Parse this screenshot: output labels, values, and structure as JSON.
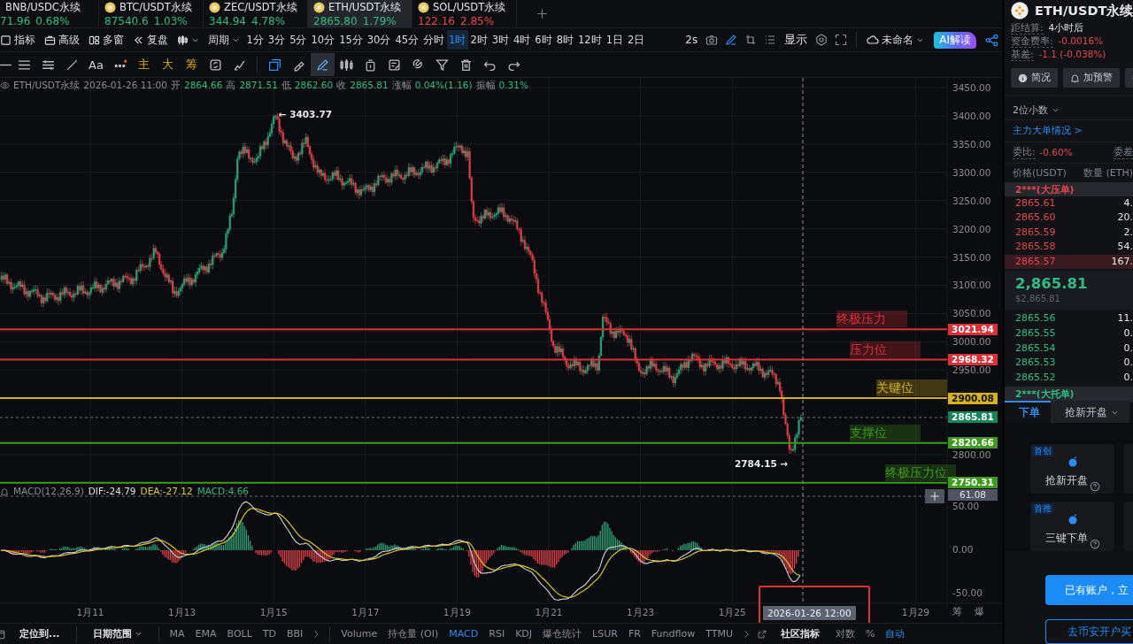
{
  "ticker_tabs": [
    {
      "symbol": "BNB/USDC永续",
      "price": "71.96",
      "change": "0.68%",
      "negative": false,
      "selected": false
    },
    {
      "symbol": "BTC/USDT永续",
      "price": "87540.6",
      "change": "1.03%",
      "negative": false,
      "selected": false
    },
    {
      "symbol": "ZEC/USDT永续",
      "price": "344.94",
      "change": "4.78%",
      "negative": false,
      "selected": false
    },
    {
      "symbol": "ETH/USDT永续",
      "price": "2865.80",
      "change": "1.79%",
      "negative": false,
      "selected": true
    },
    {
      "symbol": "SOL/USDT永续",
      "price": "122.16",
      "change": "2.85%",
      "negative": true,
      "selected": false
    }
  ],
  "toolbar": {
    "tools": [
      {
        "label": "指标"
      },
      {
        "label": "高级"
      },
      {
        "label": "多窗"
      },
      {
        "label": "复盘"
      }
    ],
    "period": "周期",
    "intervals": [
      {
        "label": "1分",
        "selected": false
      },
      {
        "label": "3分",
        "selected": false
      },
      {
        "label": "5分",
        "selected": false
      },
      {
        "label": "10分",
        "selected": false
      },
      {
        "label": "15分",
        "selected": false
      },
      {
        "label": "30分",
        "selected": false
      },
      {
        "label": "45分",
        "selected": false
      },
      {
        "label": "分时",
        "selected": false
      },
      {
        "label": "1时",
        "selected": true
      },
      {
        "label": "2时",
        "selected": false
      },
      {
        "label": "3时",
        "selected": false
      },
      {
        "label": "4时",
        "selected": false
      },
      {
        "label": "6时",
        "selected": false
      },
      {
        "label": "8时",
        "selected": false
      },
      {
        "label": "12时",
        "selected": false
      },
      {
        "label": "1日",
        "selected": false
      },
      {
        "label": "2日",
        "selected": false
      }
    ],
    "refresh": "2s",
    "display": "显示",
    "layout_name": "未命名",
    "ai_button": "AI解读"
  },
  "drawing_tools": [
    {
      "kind": "icon",
      "selected": false,
      "active": false
    },
    {
      "kind": "icon",
      "selected": false,
      "active": false
    },
    {
      "kind": "icon",
      "selected": false,
      "active": false
    },
    {
      "kind": "icon",
      "selected": false,
      "active": false
    },
    {
      "kind": "text",
      "label": "Aa"
    },
    {
      "kind": "icon",
      "selected": false,
      "active": false
    },
    {
      "kind": "quick",
      "label": "主"
    },
    {
      "kind": "quick",
      "label": "大"
    },
    {
      "kind": "quick",
      "label": "筹"
    },
    {
      "kind": "icon",
      "selected": false,
      "active": false
    },
    {
      "kind": "icon",
      "selected": false,
      "active": false
    },
    {
      "kind": "icon",
      "selected": false,
      "active": true
    },
    {
      "kind": "icon",
      "selected": false,
      "active": false
    },
    {
      "kind": "icon",
      "selected": true,
      "active": false
    },
    {
      "kind": "icon",
      "selected": false,
      "active": false
    },
    {
      "kind": "icon",
      "selected": false,
      "active": false
    },
    {
      "kind": "icon",
      "selected": false,
      "active": false
    },
    {
      "kind": "icon",
      "selected": false,
      "active": false
    },
    {
      "kind": "icon",
      "selected": false,
      "active": false
    },
    {
      "kind": "icon",
      "selected": false,
      "active": false
    },
    {
      "kind": "icon",
      "selected": false,
      "active": false
    },
    {
      "kind": "icon",
      "selected": false,
      "active": false
    }
  ],
  "info_line": {
    "symbol": "ETH/USDT永续",
    "time": "2026-01-26 11:00",
    "fields": [
      {
        "label": "开",
        "value": "2864.66"
      },
      {
        "label": "高",
        "value": "2871.51"
      },
      {
        "label": "低",
        "value": "2862.60"
      },
      {
        "label": "收",
        "value": "2865.81"
      },
      {
        "label": "涨幅",
        "value": "0.04%(1.16)"
      },
      {
        "label": "振幅",
        "value": "0.31%"
      }
    ]
  },
  "chart": {
    "price_ticks": [
      "3450.00",
      "3400.00",
      "3350.00",
      "3300.00",
      "3250.00",
      "3200.00",
      "3150.00",
      "3100.00",
      "3050.00",
      "3000.00",
      "2950.00",
      "2800.00"
    ],
    "high_marker": "← 3403.77",
    "low_marker": "2784.15 →",
    "levels": [
      {
        "label": "终极压力",
        "price": "3021.94",
        "color": "#d9303a"
      },
      {
        "label": "压力位",
        "price": "2968.32",
        "color": "#d9303a"
      },
      {
        "label": "关键位",
        "price": "2900.08",
        "color": "#d4b21f"
      },
      {
        "label": "支撑位",
        "price": "2820.66",
        "color": "#3f9a1d"
      },
      {
        "label": "终极压力位",
        "price": "2750.31",
        "color": "#3f9a1d"
      }
    ],
    "current_price": "2865.81",
    "crosshair_time": "2026-01-26 12:00",
    "time_labels": [
      "1月11",
      "1月13",
      "1月15",
      "1月17",
      "1月19",
      "1月21",
      "1月23",
      "1月25",
      "1月29"
    ],
    "axis_corner": [
      "筹",
      "爆"
    ]
  },
  "macd": {
    "title": "MACD(12,26,9)",
    "dif": "DIF:-24.79",
    "dea": "DEA:-27.12",
    "macd": "MACD:4.66",
    "ticks": [
      "50.00",
      "0.00",
      "-50.00"
    ],
    "cursor_value": "61.08"
  },
  "bottom_bar": {
    "locate": "定位到...",
    "date_range": "日期范围",
    "main_indicators": [
      "MA",
      "EMA",
      "BOLL",
      "TD",
      "BBI"
    ],
    "sub_indicators": [
      {
        "label": "Volume",
        "selected": false
      },
      {
        "label": "持仓量 (OI)",
        "selected": false
      },
      {
        "label": "MACD",
        "selected": true
      },
      {
        "label": "RSI",
        "selected": false
      },
      {
        "label": "KDJ",
        "selected": false
      },
      {
        "label": "爆仓统计",
        "selected": false
      },
      {
        "label": "LSUR",
        "selected": false
      },
      {
        "label": "FR",
        "selected": false
      },
      {
        "label": "Fundflow",
        "selected": false
      },
      {
        "label": "TTMU",
        "selected": false
      }
    ],
    "community": "社区指标",
    "options": [
      {
        "label": "对数",
        "selected": false
      },
      {
        "label": "%",
        "selected": false
      },
      {
        "label": "自动",
        "selected": true
      }
    ]
  },
  "side_panel": {
    "symbol": "ETH/USDT永续",
    "stats": [
      {
        "label": "距结算:",
        "value": "4小时后",
        "negative": false
      },
      {
        "label": "资金费率:",
        "value": "-0.0016%",
        "negative": true
      },
      {
        "label": "基差:",
        "value": "-1.1 (-0.038%)",
        "negative": true
      }
    ],
    "buttons": [
      "简况",
      "加预警"
    ],
    "decimals": "2位小数",
    "big_orders_link": "主力大单情况 >",
    "ratio_label": "委比:",
    "ratio_value": "-0.60%",
    "diff_label": "委差",
    "columns": [
      "价格(USDT)",
      "数量 (ETH)"
    ],
    "ask_header": "2***(大压单)",
    "asks": [
      {
        "price": "2865.61",
        "amount": "4.",
        "highlight": false
      },
      {
        "price": "2865.60",
        "amount": "20.",
        "highlight": false
      },
      {
        "price": "2865.59",
        "amount": "2.",
        "highlight": false
      },
      {
        "price": "2865.58",
        "amount": "54.",
        "highlight": false
      },
      {
        "price": "2865.57",
        "amount": "167.",
        "highlight": true
      }
    ],
    "last_price": "2,865.81",
    "last_price_usd": "$2,865.81",
    "bids": [
      {
        "price": "2865.56",
        "amount": "11.",
        "highlight": false
      },
      {
        "price": "2865.55",
        "amount": "0.",
        "highlight": false
      },
      {
        "price": "2865.54",
        "amount": "0.",
        "highlight": false
      },
      {
        "price": "2865.53",
        "amount": "0.",
        "highlight": false
      },
      {
        "price": "2865.52",
        "amount": "0.",
        "highlight": false
      }
    ],
    "bid_header": "2***(大托单)",
    "order_tabs": [
      {
        "label": "下单",
        "selected": true
      },
      {
        "label": "抢新开盘",
        "selected": false
      }
    ],
    "cards": [
      {
        "badge": "首创",
        "title": "抢新开盘"
      },
      {
        "badge": "首推",
        "title": "三键下单"
      }
    ],
    "login_button": "已有账户，立",
    "signup_button": "去币安开户买"
  }
}
